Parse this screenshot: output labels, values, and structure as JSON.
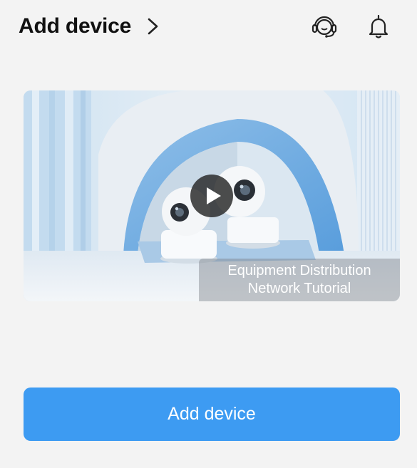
{
  "header": {
    "title": "Add device",
    "chevron_icon": "chevron-right-icon",
    "support_icon": "customer-service-headset-icon",
    "notifications_icon": "bell-icon"
  },
  "tutorial_card": {
    "caption_line1": "Equipment Distribution",
    "caption_line2": "Network Tutorial",
    "play_icon": "play-icon"
  },
  "primary_action": {
    "label": "Add device"
  },
  "colors": {
    "background": "#f3f3f3",
    "accent": "#3d9bf2",
    "title_text": "#111111"
  }
}
